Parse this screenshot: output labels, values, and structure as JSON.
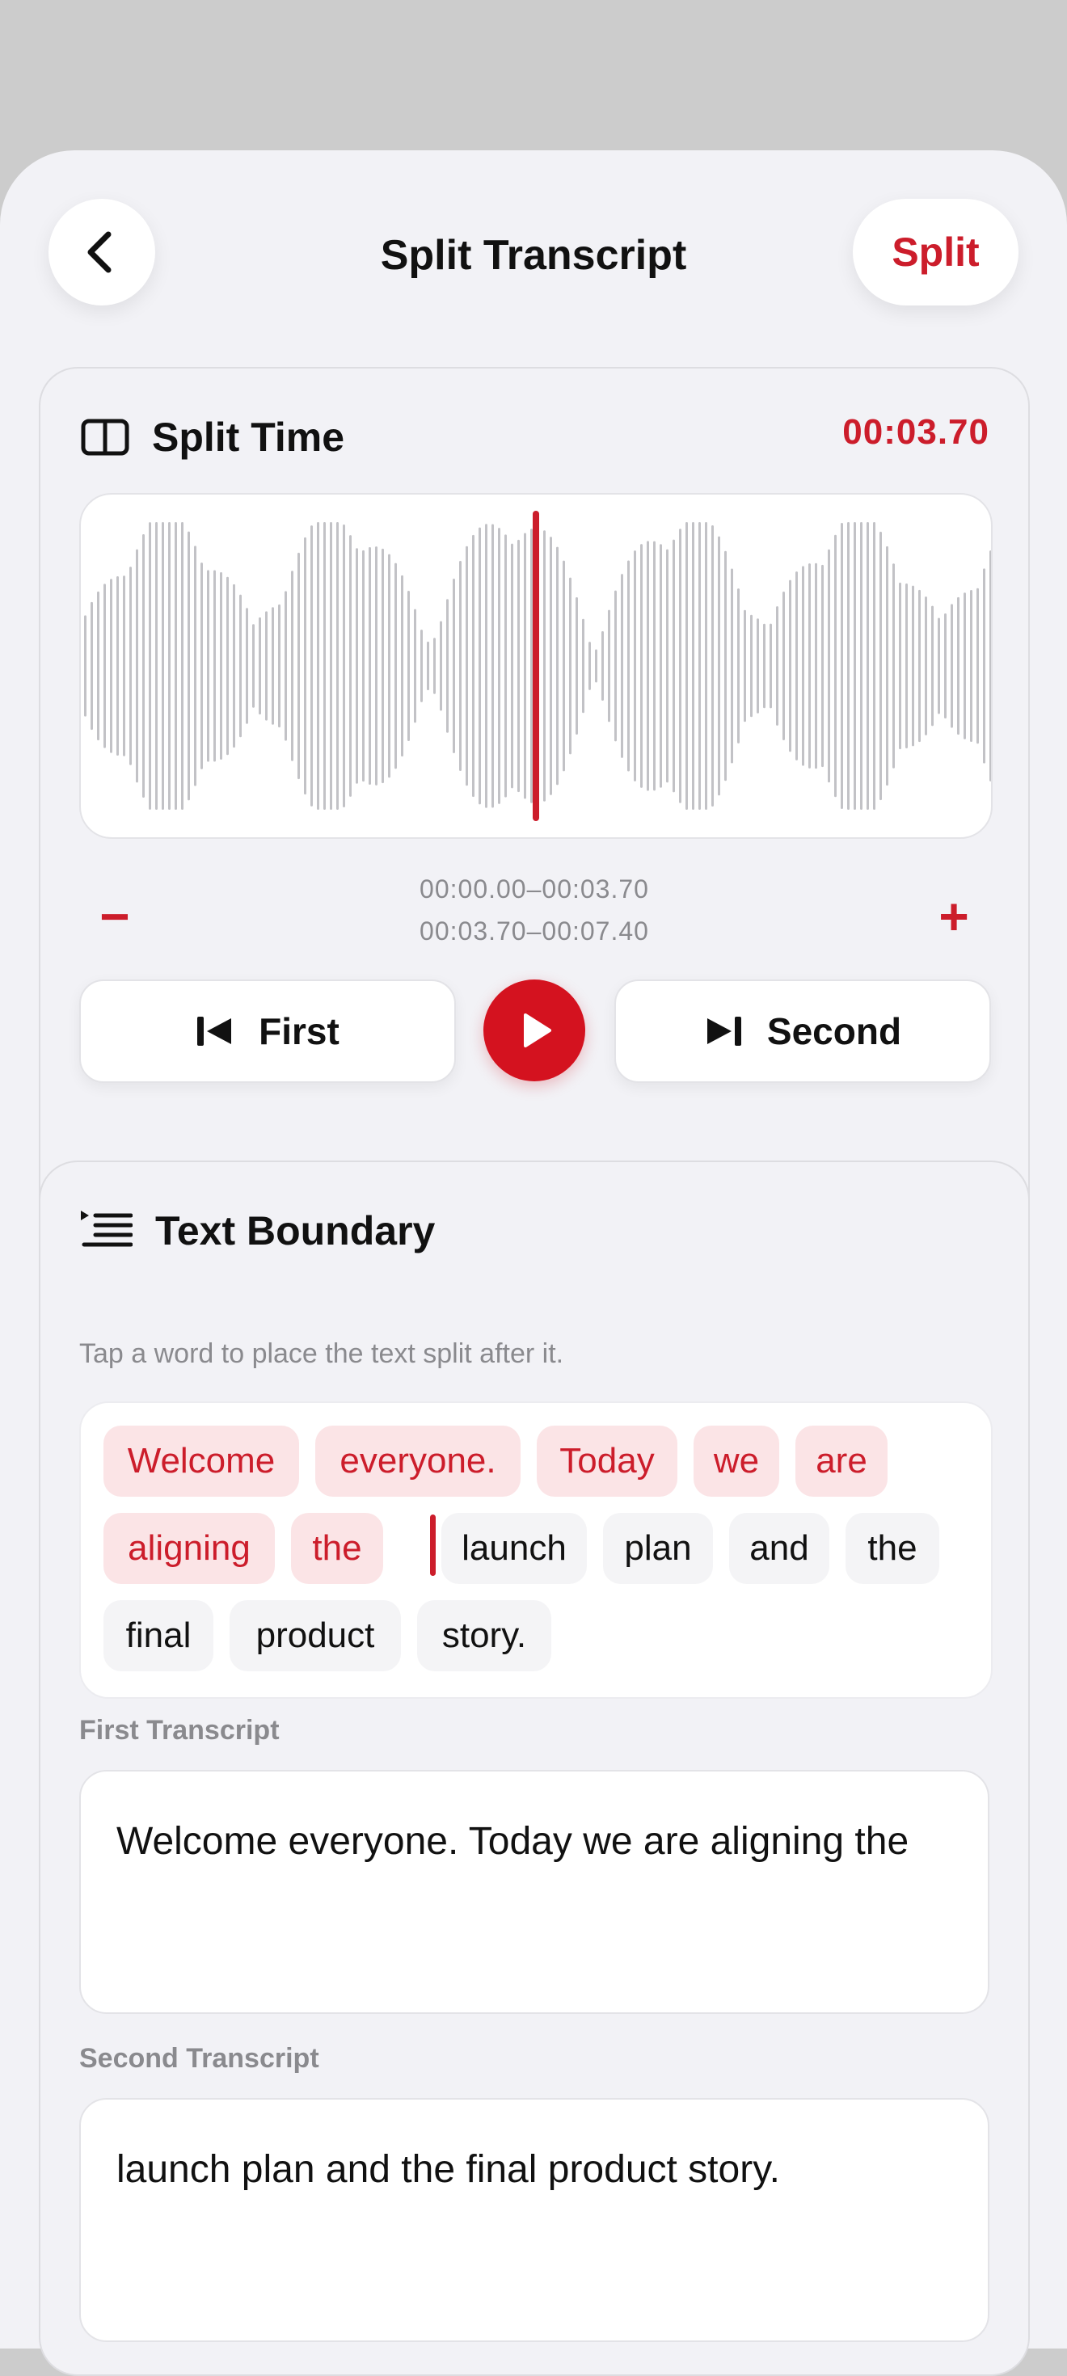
{
  "header": {
    "title": "Split Transcript",
    "split_label": "Split"
  },
  "split_time": {
    "label": "Split Time",
    "value": "00:03.70",
    "playhead_fraction": 0.5,
    "ranges": [
      "00:00.00–00:03.70",
      "00:03.70–00:07.40"
    ],
    "zoom_out_symbol": "−",
    "zoom_in_symbol": "+",
    "first_label": "First",
    "second_label": "Second"
  },
  "text_boundary": {
    "label": "Text Boundary",
    "hint": "Tap a word to place the text split after it.",
    "words": [
      "Welcome",
      "everyone.",
      "Today",
      "we",
      "are",
      "aligning",
      "the",
      "launch",
      "plan",
      "and",
      "the",
      "final",
      "product",
      "story."
    ],
    "split_after_index": 6
  },
  "first_transcript": {
    "label": "First Transcript",
    "text": "Welcome everyone. Today we are aligning the"
  },
  "second_transcript": {
    "label": "Second Transcript",
    "text": "launch plan and the final product story."
  },
  "colors": {
    "accent": "#cc1d2b",
    "accent_fill": "#d4121f",
    "chip_selected_bg": "#fbe4e6",
    "waveform_bar": "#c2c2c6"
  },
  "icons": {
    "back": "chevron-left-icon",
    "split_time": "split-columns-icon",
    "text_boundary": "list-indent-icon",
    "first": "skip-back-icon",
    "play": "play-icon",
    "second": "skip-forward-icon"
  }
}
